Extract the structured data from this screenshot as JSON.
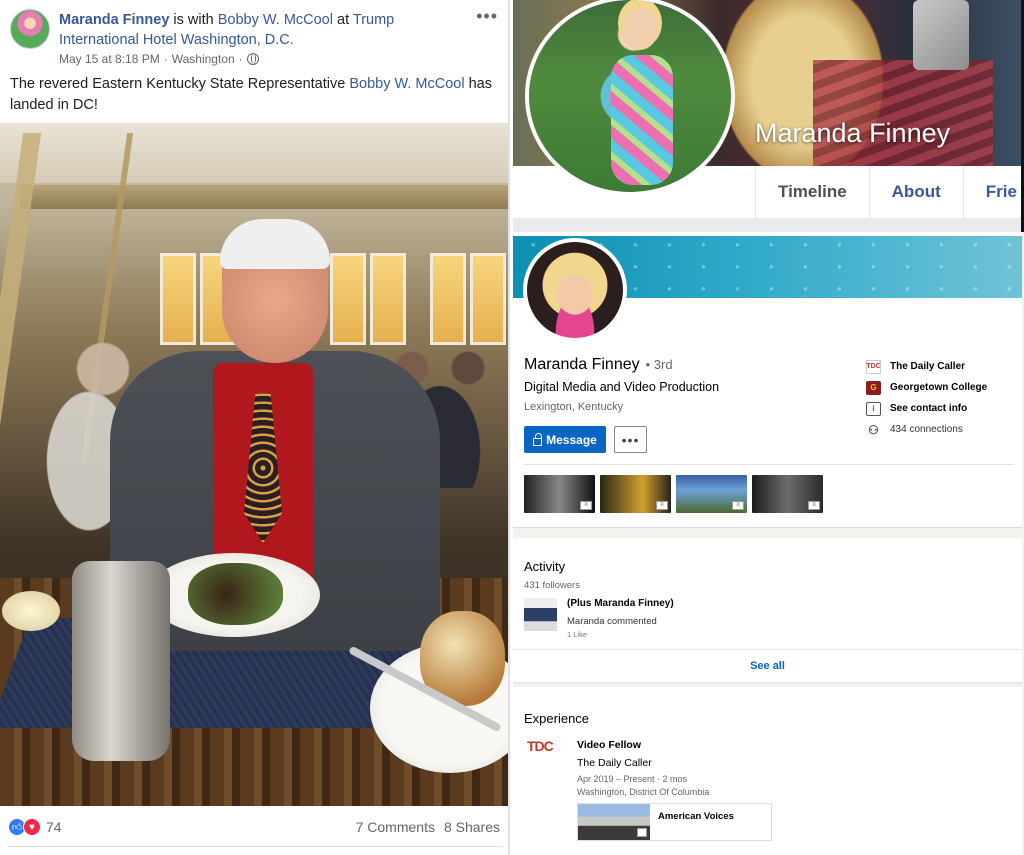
{
  "fb_post": {
    "author": "Maranda Finney",
    "with_text": " is with ",
    "tagged": "Bobby W. McCool",
    "at_text": " at ",
    "place": "Trump International Hotel Washington, D.C.",
    "date": "May 15 at 8:18 PM",
    "location": "Washington",
    "text_before": "The revered Eastern Kentucky State Representative ",
    "text_link": "Bobby W. McCool",
    "text_after": " has landed in DC!",
    "reaction_count": "74",
    "comments": "7 Comments",
    "shares": "8 Shares",
    "icons": {
      "like": "like-icon",
      "love": "love-icon",
      "privacy": "globe-icon",
      "menu": "more-dots-icon"
    }
  },
  "fb_profile": {
    "name": "Maranda Finney",
    "tabs": [
      "Timeline",
      "About",
      "Frie"
    ]
  },
  "linkedin": {
    "name": "Maranda Finney",
    "degree": "3rd",
    "headline": "Digital Media and Video Production",
    "location": "Lexington, Kentucky",
    "message_label": "Message",
    "more_label": "•••",
    "side": [
      {
        "icon": "the-daily-caller-logo",
        "text": "The Daily Caller"
      },
      {
        "icon": "georgetown-college-logo",
        "text": "Georgetown College"
      },
      {
        "icon": "contact-card-icon",
        "text": "See contact info"
      },
      {
        "icon": "connections-icon",
        "text": "434 connections"
      }
    ],
    "media_count": 4,
    "activity": {
      "title": "Activity",
      "followers": "431 followers",
      "post_title": "(Plus Maranda Finney)",
      "post_comment": "Maranda commented",
      "post_likes": "1 Like",
      "see_all": "See all"
    },
    "experience": {
      "title": "Experience",
      "logo_text": "TDC",
      "role": "Video Fellow",
      "company": "The Daily Caller",
      "dates": "Apr 2019 – Present  ·  2 mos",
      "location": "Washington, District Of Columbia",
      "media_title": "American Voices"
    }
  },
  "colors": {
    "fb_link": "#385898",
    "li_blue": "#0a66c2",
    "like": "#2f7bf6",
    "love": "#f0284a"
  }
}
